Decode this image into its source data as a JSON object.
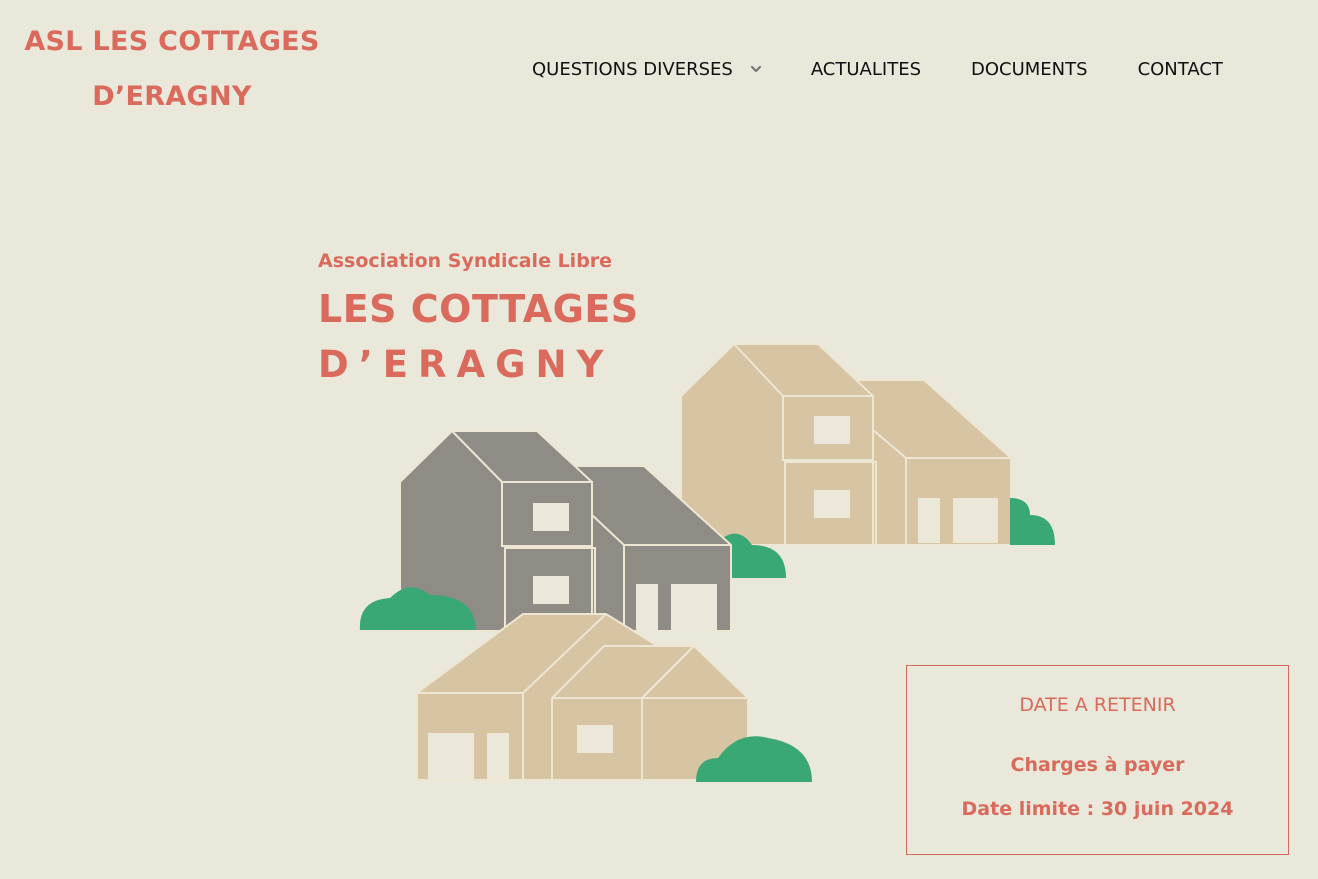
{
  "header": {
    "site_title_line1": "ASL LES COTTAGES",
    "site_title_line2": "D’ERAGNY"
  },
  "nav": {
    "items": [
      {
        "label": "QUESTIONS DIVERSES",
        "has_dropdown": true,
        "icon": "chevron-down-icon"
      },
      {
        "label": "ACTUALITES"
      },
      {
        "label": "DOCUMENTS"
      },
      {
        "label": "CONTACT"
      }
    ]
  },
  "hero": {
    "logo_line1": "Association Syndicale Libre",
    "logo_line2": "LES COTTAGES",
    "logo_line3": "D’ERAGNY"
  },
  "date_box": {
    "heading": "DATE A RETENIR",
    "line1": "Charges à payer",
    "line2": "Date limite : 30 juin 2024"
  },
  "colors": {
    "background": "#e9e8db",
    "accent": "#d96a5c",
    "house_grey": "#8f8c86",
    "house_beige": "#d6c4a2",
    "bush_green": "#3aa874",
    "window": "#ebe8da"
  }
}
